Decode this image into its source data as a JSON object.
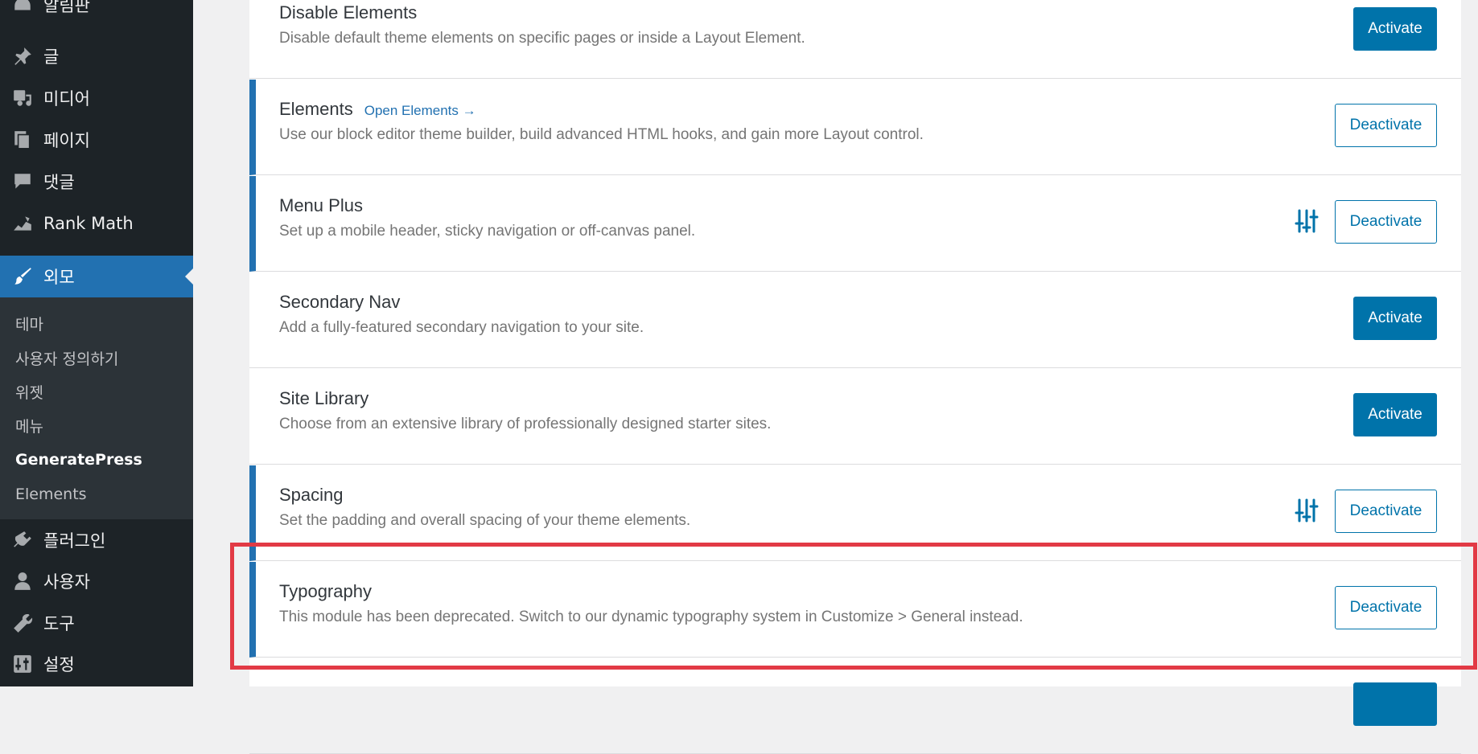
{
  "sidebar": {
    "items": [
      {
        "label": "알림판",
        "icon": "dashboard-icon"
      },
      {
        "label": "글",
        "icon": "pin-icon"
      },
      {
        "label": "미디어",
        "icon": "media-icon"
      },
      {
        "label": "페이지",
        "icon": "pages-icon"
      },
      {
        "label": "댓글",
        "icon": "comments-icon"
      },
      {
        "label": "Rank Math",
        "icon": "rank-math-icon"
      },
      {
        "label": "외모",
        "icon": "paintbrush-icon",
        "active": true
      },
      {
        "label": "플러그인",
        "icon": "plugin-icon"
      },
      {
        "label": "사용자",
        "icon": "user-icon"
      },
      {
        "label": "도구",
        "icon": "wrench-icon"
      },
      {
        "label": "설정",
        "icon": "settings-sliders-icon"
      }
    ],
    "submenu": [
      {
        "label": "테마"
      },
      {
        "label": "사용자 정의하기"
      },
      {
        "label": "위젯"
      },
      {
        "label": "메뉴"
      },
      {
        "label": "GeneratePress",
        "current": true
      },
      {
        "label": "Elements"
      }
    ]
  },
  "modules": [
    {
      "title": "Disable Elements",
      "description": "Disable default theme elements on specific pages or inside a Layout Element.",
      "active": false,
      "button": "Activate"
    },
    {
      "title": "Elements",
      "link": "Open Elements →",
      "description": "Use our block editor theme builder, build advanced HTML hooks, and gain more Layout control.",
      "active": true,
      "button": "Deactivate"
    },
    {
      "title": "Menu Plus",
      "description": "Set up a mobile header, sticky navigation or off-canvas panel.",
      "active": true,
      "button": "Deactivate",
      "settings_icon": "sliders-icon"
    },
    {
      "title": "Secondary Nav",
      "description": "Add a fully-featured secondary navigation to your site.",
      "active": false,
      "button": "Activate"
    },
    {
      "title": "Site Library",
      "description": "Choose from an extensive library of professionally designed starter sites.",
      "active": false,
      "button": "Activate"
    },
    {
      "title": "Spacing",
      "description": "Set the padding and overall spacing of your theme elements.",
      "active": true,
      "button": "Deactivate",
      "settings_icon": "sliders-icon"
    },
    {
      "title": "Typography",
      "description": "This module has been deprecated. Switch to our dynamic typography system in Customize > General instead.",
      "active": true,
      "button": "Deactivate"
    }
  ],
  "colors": {
    "sidebar_bg": "#1d2327",
    "submenu_bg": "#2c3338",
    "accent": "#2271b1",
    "button_blue": "#0073aa",
    "highlight": "#e23a45"
  }
}
